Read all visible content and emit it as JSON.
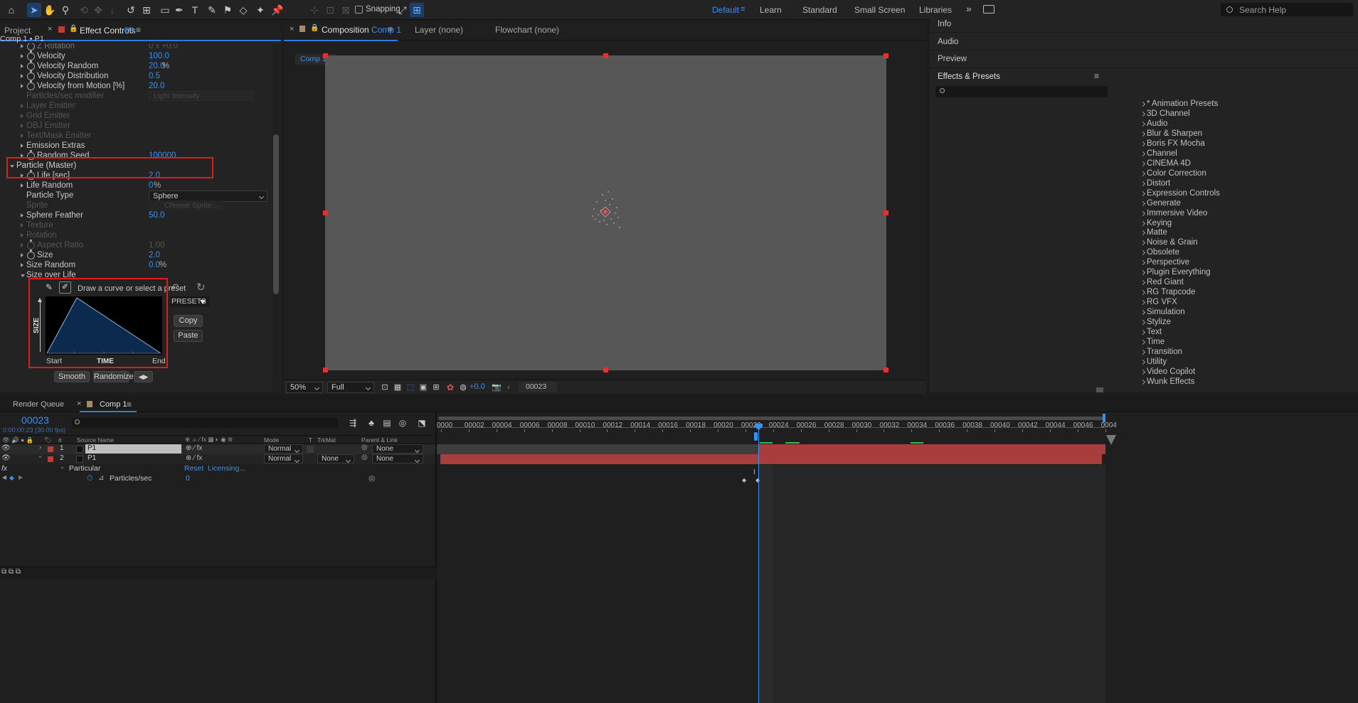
{
  "toolbar": {
    "snapping": "Snapping",
    "workspaces": [
      "Default",
      "Learn",
      "Standard",
      "Small Screen",
      "Libraries"
    ],
    "active_workspace": "Default",
    "search_placeholder": "Search Help",
    "more": "»"
  },
  "left_panel": {
    "tab_project": "Project",
    "tab_effect": "Effect Controls",
    "tab_effect_layer": "P1",
    "breadcrumb": "Comp 1 • P1",
    "rows": [
      {
        "label": "Z Rotation",
        "value": "0 x +0.0",
        "indent": 2,
        "dim": false
      },
      {
        "label": "Velocity",
        "value": "100.0",
        "indent": 2
      },
      {
        "label": "Velocity Random",
        "value": "20.0",
        "unit": "%",
        "indent": 2
      },
      {
        "label": "Velocity Distribution",
        "value": "0.5",
        "indent": 2
      },
      {
        "label": "Velocity from Motion [%]",
        "value": "20.0",
        "indent": 2
      },
      {
        "label": "Particles/sec modifier",
        "value": "Light Intensity",
        "indent": 1,
        "dim": true
      },
      {
        "label": "Layer Emitter",
        "indent": 1,
        "dim": true
      },
      {
        "label": "Grid Emitter",
        "indent": 1,
        "dim": true
      },
      {
        "label": "OBJ Emitter",
        "indent": 1,
        "dim": true
      },
      {
        "label": "Text/Mask Emitter",
        "indent": 1,
        "dim": true
      },
      {
        "label": "Emission Extras",
        "indent": 1
      },
      {
        "label": "Random Seed",
        "value": "100000",
        "indent": 2
      }
    ],
    "particle_master": "Particle (Master)",
    "rows2": [
      {
        "label": "Life [sec]",
        "value": "2.0"
      },
      {
        "label": "Life Random",
        "value": "0",
        "unit": "%"
      },
      {
        "label": "Particle Type",
        "value": "Sphere"
      },
      {
        "label": "Sprite",
        "value": "Choose Sprite..."
      },
      {
        "label": "Sphere Feather",
        "value": "50.0"
      },
      {
        "label": "Texture"
      },
      {
        "label": "Rotation"
      },
      {
        "label": "Aspect Ratio",
        "value": "1.00"
      },
      {
        "label": "Size",
        "value": "2.0"
      },
      {
        "label": "Size Random",
        "value": "0.0",
        "unit": "%"
      },
      {
        "label": "Size over Life"
      }
    ],
    "curve": {
      "hint": "Draw a curve or select a preset",
      "presets": "PRESETS",
      "copy": "Copy",
      "paste": "Paste",
      "axis_y": "SIZE",
      "axis_x": "TIME",
      "start": "Start",
      "end": "End",
      "smooth": "Smooth",
      "randomize": "Randomize"
    }
  },
  "composition": {
    "tab": "Composition",
    "comp_name": "Comp 1",
    "layer_tab": "Layer (none)",
    "flowchart_tab": "Flowchart (none)",
    "crumb": "Comp 1",
    "zoom": "50%",
    "resolution": "Full",
    "exposure": "+0.0",
    "timecode": "00023"
  },
  "right_panel": {
    "info": "Info",
    "audio": "Audio",
    "preview": "Preview",
    "effects_presets": "Effects & Presets",
    "items": [
      "* Animation Presets",
      "3D Channel",
      "Audio",
      "Blur & Sharpen",
      "Boris FX Mocha",
      "Channel",
      "CINEMA 4D",
      "Color Correction",
      "Distort",
      "Expression Controls",
      "Generate",
      "Immersive Video",
      "Keying",
      "Matte",
      "Noise & Grain",
      "Obsolete",
      "Perspective",
      "Plugin Everything",
      "Red Giant",
      "RG Trapcode",
      "RG VFX",
      "Simulation",
      "Stylize",
      "Text",
      "Time",
      "Transition",
      "Utility",
      "Video Copilot",
      "Wunk Effects"
    ]
  },
  "timeline": {
    "render_queue": "Render Queue",
    "comp_tab": "Comp 1",
    "timecode": "00023",
    "timecode_sub": "0:00:00:23 (30.00 fps)",
    "headers": {
      "source": "Source Name",
      "mode": "Mode",
      "t": "T",
      "trkmat": "TrkMat",
      "parent": "Parent & Link"
    },
    "layers": [
      {
        "num": "1",
        "name": "P1",
        "mode": "Normal",
        "trkmat": "",
        "parent": "None"
      },
      {
        "num": "2",
        "name": "P1",
        "mode": "Normal",
        "trkmat": "None",
        "parent": "None"
      }
    ],
    "effect": "Particular",
    "reset": "Reset",
    "licensing": "Licensing...",
    "property": "Particles/sec",
    "property_value": "0",
    "ticks": [
      "0000",
      "00002",
      "00004",
      "00006",
      "00008",
      "00010",
      "00012",
      "00014",
      "00016",
      "00018",
      "00020",
      "00022",
      "00024",
      "00026",
      "00028",
      "00030",
      "00032",
      "00034",
      "00036",
      "00038",
      "00040",
      "00042",
      "00044",
      "00046",
      "0004"
    ]
  }
}
